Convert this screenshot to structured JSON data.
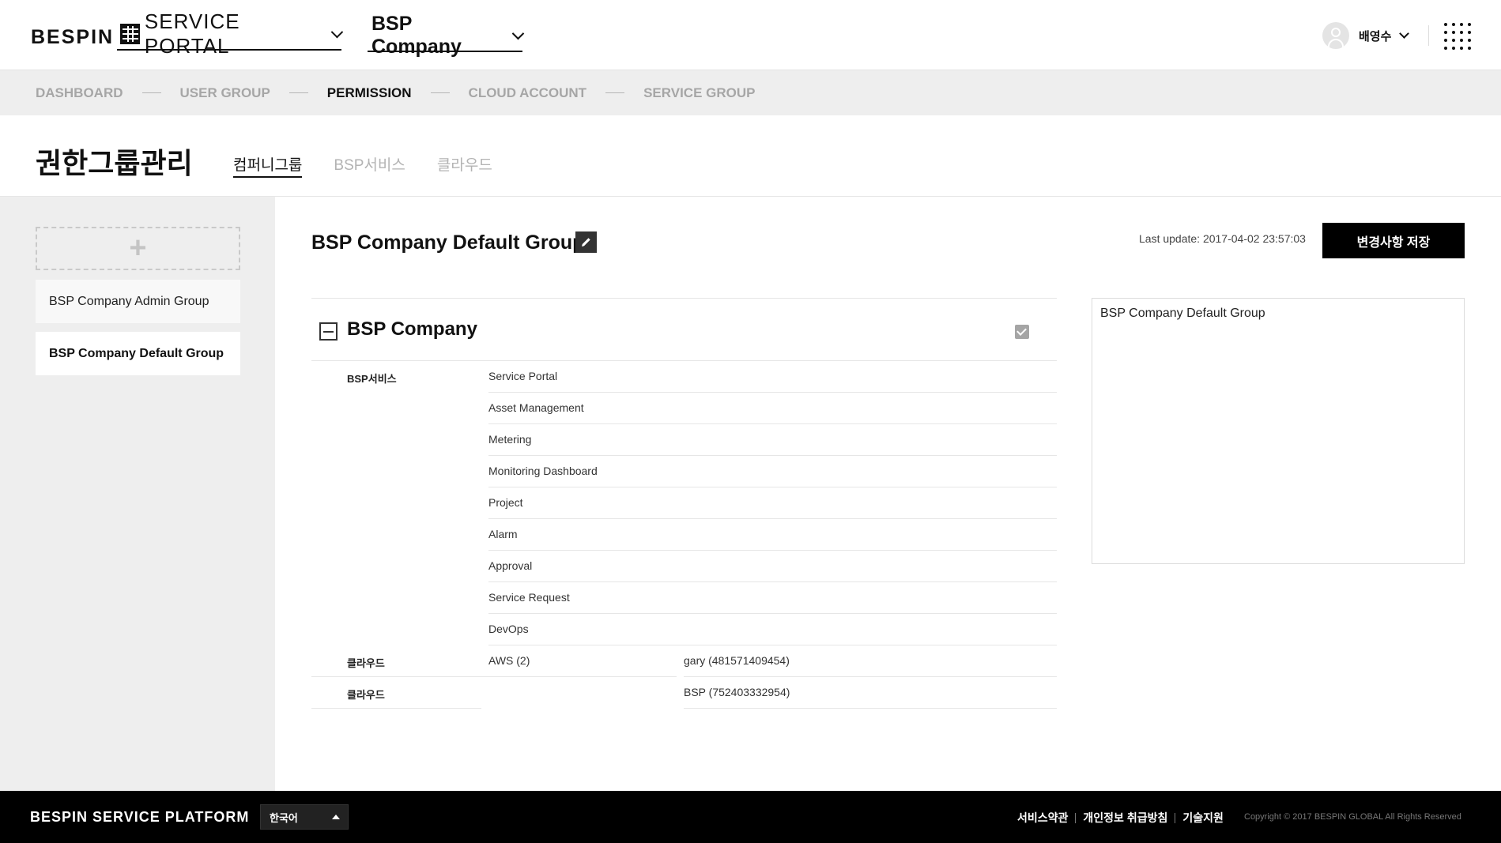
{
  "header": {
    "logo": "BESPIN",
    "portal_label": "SERVICE PORTAL",
    "company_label": "BSP Company",
    "user_name": "배영수"
  },
  "stepnav": {
    "items": [
      {
        "label": "DASHBOARD",
        "active": false
      },
      {
        "label": "USER GROUP",
        "active": false
      },
      {
        "label": "PERMISSION",
        "active": true
      },
      {
        "label": "CLOUD ACCOUNT",
        "active": false
      },
      {
        "label": "SERVICE GROUP",
        "active": false
      }
    ]
  },
  "page": {
    "title": "권한그룹관리",
    "tabs": [
      {
        "label": "컴퍼니그룹",
        "active": true
      },
      {
        "label": "BSP서비스",
        "active": false
      },
      {
        "label": "클라우드",
        "active": false
      }
    ]
  },
  "sidebar": {
    "add_symbol": "+",
    "groups": [
      {
        "label": "BSP Company Admin Group",
        "active": false
      },
      {
        "label": "BSP Company Default Group",
        "active": true
      }
    ]
  },
  "main": {
    "group_title": "BSP Company Default Group",
    "last_update": "Last update: 2017-04-02 23:57:03",
    "save_label": "변경사항 저장",
    "description": "BSP Company Default Group",
    "perm": {
      "company": "BSP Company",
      "bsp_category": "BSP서비스",
      "bsp_services": [
        "Service Portal",
        "Asset Management",
        "Metering",
        "Monitoring Dashboard",
        "Project",
        "Alarm",
        "Approval",
        "Service Request",
        "DevOps"
      ],
      "cloud_rows": [
        {
          "category": "클라우드",
          "provider": "AWS (2)",
          "account": "gary (481571409454)"
        },
        {
          "category": "클라우드",
          "provider": "",
          "account": "BSP (752403332954)"
        }
      ]
    }
  },
  "footer": {
    "logo": "BESPIN SERVICE PLATFORM",
    "language": "한국어",
    "links": [
      "서비스약관",
      "개인정보 취급방침",
      "기술지원"
    ],
    "copyright": "Copyright © 2017 BESPIN GLOBAL All Rights Reserved"
  }
}
